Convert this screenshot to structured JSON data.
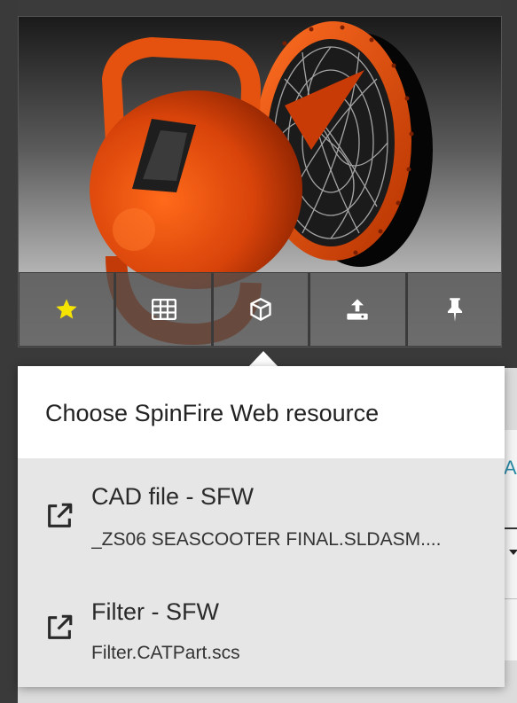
{
  "toolbar": {
    "buttons": [
      {
        "name": "favorite-button",
        "icon": "star-icon",
        "color": "#f5e400"
      },
      {
        "name": "table-button",
        "icon": "table-icon",
        "color": "#ffffff"
      },
      {
        "name": "3d-model-button",
        "icon": "cube-icon",
        "color": "#ffffff"
      },
      {
        "name": "upload-button",
        "icon": "upload-icon",
        "color": "#ffffff"
      },
      {
        "name": "pin-button",
        "icon": "pin-icon",
        "color": "#ffffff"
      }
    ]
  },
  "popover": {
    "title": "Choose SpinFire Web resource",
    "items": [
      {
        "label": "CAD file - SFW",
        "file": "_ZS06 SEASCOOTER FINAL.SLDASM....",
        "icon": "external-link-icon"
      },
      {
        "label": "Filter - SFW",
        "file": "Filter.CATPart.scs",
        "icon": "external-link-icon"
      }
    ]
  },
  "background": {
    "partial_text": "A",
    "accent": "#2a8aa6"
  },
  "colors": {
    "model_orange": "#e24a0c",
    "popover_bg": "#e6e6e6",
    "header_bg": "#ffffff"
  }
}
